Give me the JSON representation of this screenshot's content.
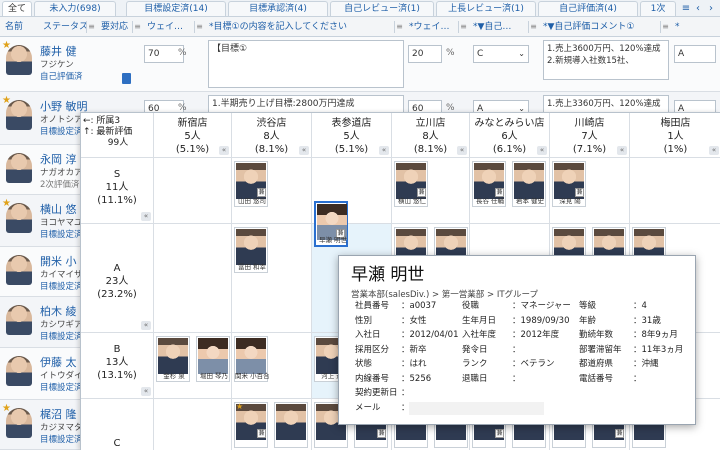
{
  "tabs": [
    {
      "label": "全て",
      "active": true
    },
    {
      "label": "未入力(698)"
    },
    {
      "label": "目標設定済(14)"
    },
    {
      "label": "目標承認済(4)"
    },
    {
      "label": "自己レビュー済(1)"
    },
    {
      "label": "上長レビュー済(1)"
    },
    {
      "label": "自己評価済(4)"
    },
    {
      "label": "1次"
    }
  ],
  "tab_controls": {
    "menu_icon": "≡",
    "prev_icon": "‹",
    "next_icon": "›"
  },
  "columns": {
    "name": "名前",
    "status": "ステータス",
    "comparison": "要対応",
    "weight1": "ウェイ…",
    "goal1": "*目標①の内容を記入してください",
    "weight2": "*ウェイ…",
    "self_eval": "*▼自己…",
    "self_comment": "*▼自己評価コメント①",
    "extra": "*"
  },
  "employees": [
    {
      "name": "藤井 健",
      "company": "フジケン",
      "status": "自己評価済",
      "star": true,
      "weight1": "70",
      "goal1": "【目標①",
      "weight2": "20",
      "self_eval": "C",
      "comment": "1.売上3600万円、120%達成\n2.新規導入社数15社、",
      "extra": "A"
    },
    {
      "name": "小野 敏明",
      "company": "オノトシア",
      "status": "目標設定済",
      "star": true,
      "weight1": "60",
      "goal1": "1.半期売り上げ目標:2800万円達成",
      "weight2": "60",
      "self_eval": "A",
      "comment": "1.売上3360万円、120%達成",
      "extra": "A"
    },
    {
      "name": "永岡 淳",
      "company": "ナガオカア",
      "status": "2次評価済",
      "status_gray": true
    },
    {
      "name": "横山 悠",
      "company": "ヨコヤマユ",
      "status": "目標設定済",
      "star": true
    },
    {
      "name": "開米 小",
      "company": "カイマイサ",
      "status": "目標設定済"
    },
    {
      "name": "柏木 綾",
      "company": "カシワギア",
      "status": "目標設定済"
    },
    {
      "name": "伊藤 太",
      "company": "イトウダイ",
      "status": "目標設定済"
    },
    {
      "name": "梶沼 隆",
      "company": "カジヌマタ",
      "status": "目標設定済",
      "star": true
    }
  ],
  "board": {
    "corner": {
      "x_axis": "←: 所属3",
      "y_axis": "↑: 最新評価",
      "total": "99人"
    },
    "columns": [
      {
        "name": "新宿店",
        "count": "5人",
        "pct": "(5.1%)"
      },
      {
        "name": "渋谷店",
        "count": "8人",
        "pct": "(8.1%)"
      },
      {
        "name": "表参道店",
        "count": "5人",
        "pct": "(5.1%)"
      },
      {
        "name": "立川店",
        "count": "8人",
        "pct": "(8.1%)"
      },
      {
        "name": "みなとみらい店",
        "count": "6人",
        "pct": "(6.1%)"
      },
      {
        "name": "川崎店",
        "count": "7人",
        "pct": "(7.1%)"
      },
      {
        "name": "梅田店",
        "count": "1人",
        "pct": "(1%)"
      }
    ],
    "rows": [
      {
        "grade": "S",
        "count": "11人",
        "pct": "(11.1%)"
      },
      {
        "grade": "A",
        "count": "23人",
        "pct": "(23.2%)"
      },
      {
        "grade": "B",
        "count": "13人",
        "pct": "(13.1%)"
      },
      {
        "grade": "C",
        "count": "",
        "pct": ""
      }
    ],
    "collapse_icon": "«",
    "cards": [
      {
        "name": "山田 悠司",
        "col": 1,
        "row": 0,
        "slot": 0,
        "tag": "兼"
      },
      {
        "name": "横山 悠仁",
        "col": 3,
        "row": 0,
        "slot": 0,
        "tag": "兼"
      },
      {
        "name": "長谷 仕輔",
        "col": 4,
        "row": 0,
        "slot": 0,
        "tag": "兼"
      },
      {
        "name": "岩本 健史",
        "col": 4,
        "row": 0,
        "slot": 1,
        "tag": ""
      },
      {
        "name": "深見 陽",
        "col": 5,
        "row": 0,
        "slot": 0,
        "tag": "兼"
      },
      {
        "name": "冨田 和幸",
        "col": 1,
        "row": 1,
        "slot": 0,
        "tag": ""
      },
      {
        "name": "早瀬 明世",
        "col": 2,
        "row": 1,
        "slot": 0,
        "tag": "兼",
        "female": true,
        "selected": true
      },
      {
        "name": "",
        "col": 3,
        "row": 1,
        "slot": 0,
        "tag": ""
      },
      {
        "name": "",
        "col": 3,
        "row": 1,
        "slot": 1,
        "tag": ""
      },
      {
        "name": "",
        "col": 5,
        "row": 1,
        "slot": 0,
        "tag": ""
      },
      {
        "name": "",
        "col": 5,
        "row": 1,
        "slot": 1,
        "tag": ""
      },
      {
        "name": "",
        "col": 6,
        "row": 1,
        "slot": 0,
        "tag": ""
      },
      {
        "name": "金杉 泉",
        "col": 0,
        "row": 2,
        "slot": 0,
        "tag": ""
      },
      {
        "name": "堀田 琴乃",
        "col": 0,
        "row": 2,
        "slot": 1,
        "tag": "",
        "female": true
      },
      {
        "name": "関米 小百合",
        "col": 1,
        "row": 2,
        "slot": 0,
        "tag": "",
        "female": true
      },
      {
        "name": "河上 遥",
        "col": 2,
        "row": 2,
        "slot": 0,
        "tag": ""
      },
      {
        "name": "",
        "col": 1,
        "row": 3,
        "slot": 0,
        "tag": "兼",
        "star": true
      },
      {
        "name": "",
        "col": 1,
        "row": 3,
        "slot": 1,
        "tag": ""
      },
      {
        "name": "",
        "col": 2,
        "row": 3,
        "slot": 0,
        "tag": ""
      },
      {
        "name": "",
        "col": 2,
        "row": 3,
        "slot": 1,
        "tag": "兼"
      },
      {
        "name": "",
        "col": 3,
        "row": 3,
        "slot": 0,
        "tag": ""
      },
      {
        "name": "",
        "col": 3,
        "row": 3,
        "slot": 1,
        "tag": ""
      },
      {
        "name": "",
        "col": 4,
        "row": 3,
        "slot": 0,
        "tag": "兼"
      },
      {
        "name": "",
        "col": 4,
        "row": 3,
        "slot": 1,
        "tag": ""
      },
      {
        "name": "",
        "col": 5,
        "row": 3,
        "slot": 0,
        "tag": ""
      },
      {
        "name": "",
        "col": 5,
        "row": 3,
        "slot": 1,
        "tag": "兼"
      },
      {
        "name": "",
        "col": 6,
        "row": 3,
        "slot": 0,
        "tag": ""
      }
    ]
  },
  "popup": {
    "name": "早瀬 明世",
    "dept": "営業本部(salesDiv.) > 第一営業部 > ITグループ",
    "fields": [
      {
        "k": "社員番号",
        "v": "：a0037"
      },
      {
        "k": "役職",
        "v": "：マネージャー"
      },
      {
        "k": "等級",
        "v": "：4"
      },
      {
        "k": "性別",
        "v": "：女性"
      },
      {
        "k": "生年月日",
        "v": "：1989/09/30"
      },
      {
        "k": "年齢",
        "v": "：31歳"
      },
      {
        "k": "入社日",
        "v": "：2012/04/01"
      },
      {
        "k": "入社年度",
        "v": "：2012年度"
      },
      {
        "k": "勤続年数",
        "v": "：8年9ヵ月"
      },
      {
        "k": "採用区分",
        "v": "：新卒"
      },
      {
        "k": "発令日",
        "v": "："
      },
      {
        "k": "部署滞留年",
        "v": "：11年3ヵ月"
      },
      {
        "k": "状態",
        "v": "：はれ"
      },
      {
        "k": "ランク",
        "v": "：ベテラン"
      },
      {
        "k": "都道府県",
        "v": "：沖縄"
      },
      {
        "k": "内線番号",
        "v": "：5256"
      },
      {
        "k": "退職日",
        "v": "："
      },
      {
        "k": "電話番号",
        "v": "："
      },
      {
        "k": "契約更新日",
        "v": "："
      },
      {
        "k": "メール",
        "v": "："
      }
    ]
  },
  "colors": {
    "link": "#1f5fa8",
    "accent": "#2a6fcf",
    "highlight": "#e6f3fb",
    "star": "#e0a21a"
  }
}
